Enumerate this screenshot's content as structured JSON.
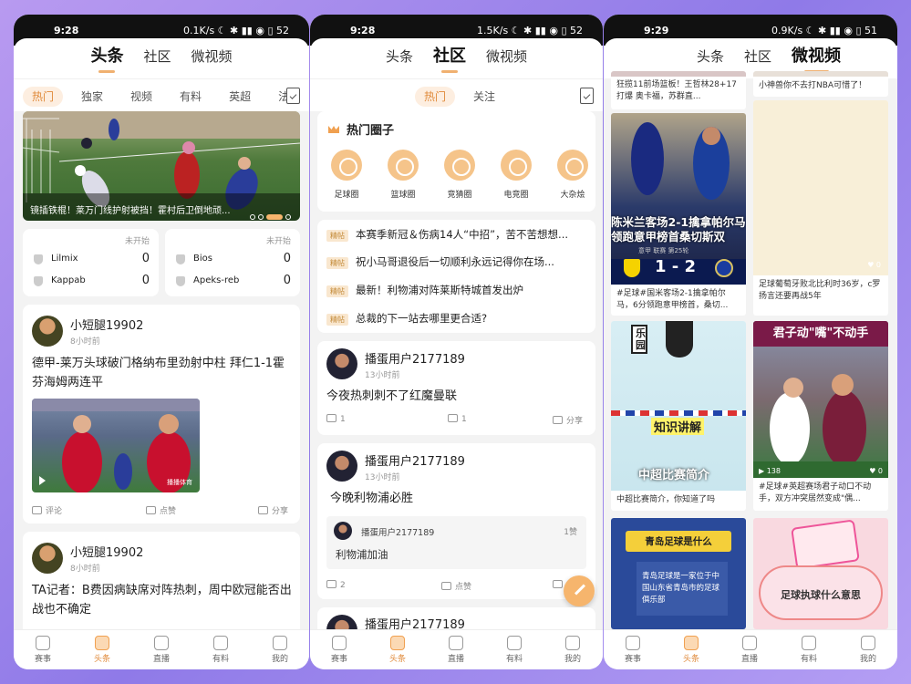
{
  "phone1": {
    "status": {
      "time": "9:28",
      "right": "0.1K/s ☾ ✱ ▮▮ ◉ ▯ 52"
    },
    "tabs": [
      "头条",
      "社区",
      "微视频"
    ],
    "subtabs": [
      "热门",
      "独家",
      "视频",
      "有料",
      "英超",
      "法甲"
    ],
    "banner_caption": "镜插铁棍！莱万门线护射被挡！霍村后卫倒地顽...",
    "matches": [
      {
        "status": "未开始",
        "team1": "Lilmix",
        "score1": "0",
        "team2": "Kappab",
        "score2": "0"
      },
      {
        "status": "未开始",
        "team1": "Bios",
        "score1": "0",
        "team2": "Apeks-reb",
        "score2": "0"
      }
    ],
    "posts": [
      {
        "user": "小短腿19902",
        "time": "8小时前",
        "text": "德甲-莱万头球破门格纳布里劲射中柱 拜仁1-1霍芬海姆两连平",
        "video_tag": "播播体育",
        "comment": "评论",
        "like": "点赞",
        "share": "分享"
      },
      {
        "user": "小短腿19902",
        "time": "8小时前",
        "text": "TA记者：B费因病缺席对阵热刺，周中欧冠能否出战也不确定"
      }
    ],
    "nav": [
      "赛事",
      "头条",
      "直播",
      "有料",
      "我的"
    ]
  },
  "phone2": {
    "status": {
      "time": "9:28",
      "right": "1.5K/s ☾ ✱ ▮▮ ◉ ▯ 52"
    },
    "tabs": [
      "头条",
      "社区",
      "微视频"
    ],
    "subtabs": [
      "热门",
      "关注"
    ],
    "hot_title": "热门圈子",
    "circles": [
      "足球圈",
      "篮球圈",
      "竞猜圈",
      "电竞圈",
      "大杂烩"
    ],
    "pinned_tag": "精帖",
    "pinned": [
      "本赛季新冠＆伤病14人“中招”，苦不苦想想...",
      "祝小马哥退役后一切顺利永远记得你在场...",
      "最新！利物浦对阵莱斯特城首发出炉",
      "总裁的下一站去哪里更合适?"
    ],
    "posts": [
      {
        "user": "播蛋用户2177189",
        "time": "13小时前",
        "text": "今夜热刺刺不了红魔曼联",
        "comments": "1",
        "likes": "1",
        "share": "分享"
      },
      {
        "user": "播蛋用户2177189",
        "time": "13小时前",
        "text": "今晚利物浦必胜",
        "reply_user": "播蛋用户2177189",
        "reply_likes": "1赞",
        "reply_text": "利物浦加油",
        "comments": "2",
        "likes": "点赞"
      },
      {
        "user": "播蛋用户2177189"
      }
    ],
    "nav": [
      "赛事",
      "头条",
      "直播",
      "有料",
      "我的"
    ]
  },
  "phone3": {
    "status": {
      "time": "9:29",
      "right": "0.9K/s ☾ ✱ ▮▮ ◉ ▯ 51"
    },
    "tabs": [
      "头条",
      "社区",
      "微视频"
    ],
    "videos": [
      {
        "title": "狂揽11前场篮板！王哲林28+17打爆 奥卡福，苏群直..."
      },
      {
        "title": "小神兽你不去打NBA可惜了！"
      },
      {
        "title": "#足球#国米客场2-1擒拿帕尔马，6分领跑意甲榜首，桑切...",
        "overlay": "陈米兰客场2-1擒拿帕尔马领跑意甲榜首桑切斯双",
        "score": "1 - 2",
        "league": "意甲 联赛 第25轮"
      },
      {
        "title": "足球葡萄牙败北比利时36岁，c罗扬言还要再战5年",
        "likes": "0"
      },
      {
        "title": "中超比赛简介，你知道了吗",
        "overlay": "知识讲解",
        "overlay2": "中超比赛简介",
        "tag": "乐园"
      },
      {
        "title": "#足球#英超赛场君子动口不动手，双方冲突居然变成\"偶...",
        "overlay": "君子动\"嘴\"不动手",
        "views": "138",
        "likes": "0"
      },
      {
        "title": "",
        "overlay": "青岛足球是什么",
        "desc": "青岛足球是一家位于中国山东省青岛市的足球俱乐部"
      },
      {
        "title": "",
        "overlay": "足球执球什么意思"
      }
    ],
    "nav": [
      "赛事",
      "头条",
      "直播",
      "有料",
      "我的"
    ]
  }
}
